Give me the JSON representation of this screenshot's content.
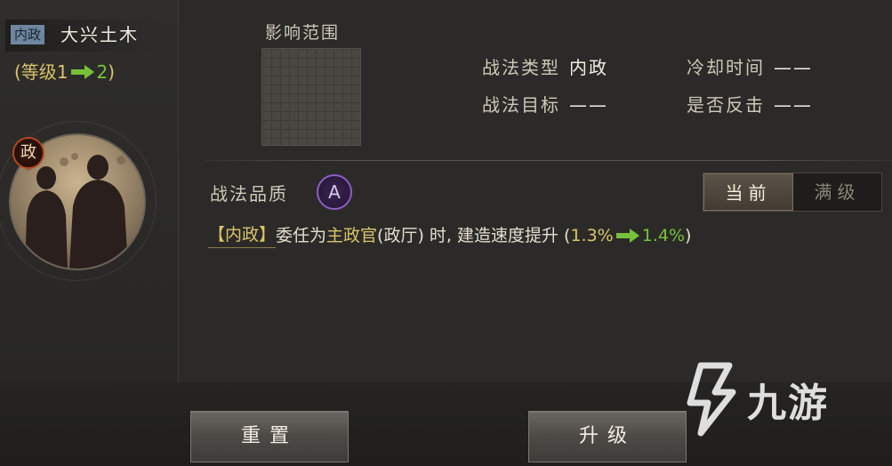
{
  "skill": {
    "category_tag": "内政",
    "name": "大兴土木",
    "level": {
      "prefix": "(等级",
      "from": "1",
      "to": "2",
      "suffix": ")"
    }
  },
  "portrait": {
    "badge": "政"
  },
  "preview": {
    "title": "影响范围"
  },
  "info": {
    "type_label": "战法类型",
    "type_value": "内政",
    "cooldown_label": "冷却时间",
    "cooldown_value": "——",
    "target_label": "战法目标",
    "target_value": "——",
    "counter_label": "是否反击",
    "counter_value": "——"
  },
  "quality": {
    "label": "战法品质",
    "grade": "A"
  },
  "toggle": {
    "current": "当前",
    "max": "满级",
    "selected": "current"
  },
  "description": {
    "tag": "【内政】",
    "part1": "委任为",
    "highlight": "主政官",
    "part2": "(政厅) 时, 建造速度提升 (",
    "from_value": "1.3%",
    "to_value": "1.4%",
    "end": ")"
  },
  "buttons": {
    "reset": "重置",
    "upgrade": "升级"
  },
  "watermark": {
    "text": "九游"
  },
  "colors": {
    "gold": "#d9c46a",
    "green": "#77c23a",
    "tag_blue": "#6f86a0",
    "quality_purple": "#8b5fc4",
    "badge_red": "#b5471f"
  }
}
